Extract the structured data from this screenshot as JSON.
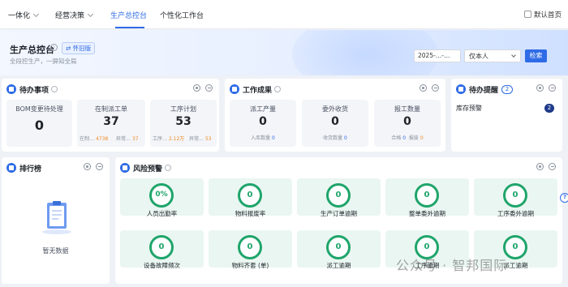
{
  "nav": {
    "items": [
      "一体化",
      "经营决策",
      "生产总控台",
      "个性化工作台"
    ],
    "default_home": "默认首页"
  },
  "header": {
    "title": "生产总控台",
    "old_version": "⇄ 怀旧版",
    "subtitle": "全段控生产，一屏知全局",
    "date_value": "2025-…-…",
    "scope": "仅本人",
    "search": "检索"
  },
  "todo": {
    "title": "待办事项",
    "items": [
      {
        "label": "BOM变更待处理",
        "value": "0"
      },
      {
        "label": "在制派工单",
        "value": "37",
        "sub1_label": "在制…",
        "sub1_value": "4738",
        "sub2_label": "异常…",
        "sub2_value": "37"
      },
      {
        "label": "工序计划",
        "value": "53",
        "sub1_label": "工序…",
        "sub1_value": "2.12万",
        "sub2_label": "异常…",
        "sub2_value": "53"
      }
    ]
  },
  "results": {
    "title": "工作成果",
    "items": [
      {
        "label": "派工产量",
        "value": "0",
        "sub_label": "入库数量",
        "sub_value": "0"
      },
      {
        "label": "委外收货",
        "value": "0",
        "sub_label": "收货数量",
        "sub_value": "0"
      },
      {
        "label": "报工数量",
        "value": "0",
        "sub1_label": "合格",
        "sub1_value": "0",
        "sub2_label": "报废",
        "sub2_value": "0"
      }
    ]
  },
  "reminder": {
    "title": "待办提醒",
    "count": "2",
    "row_label": "库存预警",
    "row_count": "2"
  },
  "ranking": {
    "title": "排行榜",
    "empty": "暂无数据"
  },
  "risk": {
    "title": "风险预警",
    "items": [
      {
        "label": "人员出勤率",
        "value": "0%"
      },
      {
        "label": "物料报废率",
        "value": "0"
      },
      {
        "label": "生产订单逾期",
        "value": "0"
      },
      {
        "label": "整单委外逾期",
        "value": "0"
      },
      {
        "label": "工序委外逾期",
        "value": "0"
      },
      {
        "label": "设备故障频次",
        "value": "0"
      },
      {
        "label": "物料齐套 (单)",
        "value": "0"
      },
      {
        "label": "派工逾期",
        "value": "0"
      },
      {
        "label": "工序逾期",
        "value": "0"
      },
      {
        "label": "派工逾期",
        "value": "0"
      }
    ]
  },
  "watermark": "公众号 · 智邦国际",
  "help": "?"
}
